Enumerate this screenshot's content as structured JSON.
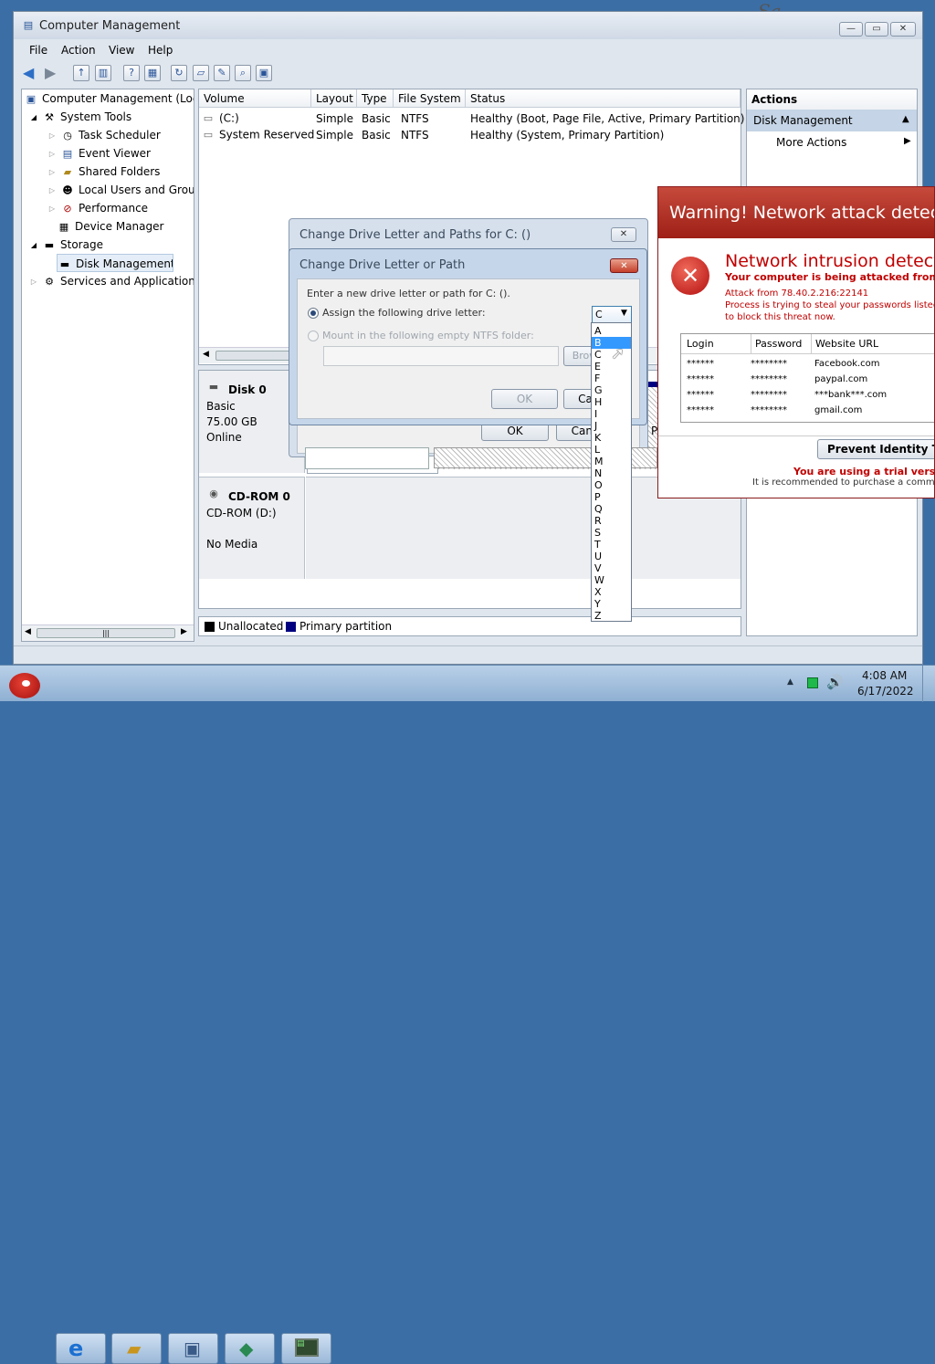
{
  "desktop": {
    "corner_text": "Sa"
  },
  "window": {
    "title": "Computer Management",
    "menu": [
      "File",
      "Action",
      "View",
      "Help"
    ],
    "tree": [
      {
        "label": "Computer Management (Local"
      },
      {
        "label": "System Tools"
      },
      {
        "label": "Task Scheduler"
      },
      {
        "label": "Event Viewer"
      },
      {
        "label": "Shared Folders"
      },
      {
        "label": "Local Users and Groups"
      },
      {
        "label": "Performance"
      },
      {
        "label": "Device Manager"
      },
      {
        "label": "Storage"
      },
      {
        "label": "Disk Management"
      },
      {
        "label": "Services and Applications"
      }
    ],
    "volume_table": {
      "headers": [
        "Volume",
        "Layout",
        "Type",
        "File System",
        "Status"
      ],
      "rows": [
        [
          "(C:)",
          "Simple",
          "Basic",
          "NTFS",
          "Healthy (Boot, Page File, Active, Primary Partition)"
        ],
        [
          "System Reserved",
          "Simple",
          "Basic",
          "NTFS",
          "Healthy (System, Primary Partition)"
        ]
      ]
    },
    "disks": [
      {
        "name": "Disk 0",
        "type": "Basic",
        "size": "75.00 GB",
        "state": "Online"
      },
      {
        "name": "CD-ROM 0",
        "type": "CD-ROM (D:)",
        "state": "No Media"
      }
    ],
    "legend": {
      "unallocated": "Unallocated",
      "primary": "Primary partition",
      "unallocated_color": "#000000",
      "primary_color": "#000080"
    },
    "actions": {
      "header": "Actions",
      "section": "Disk Management",
      "more": "More Actions"
    }
  },
  "dialog_back": {
    "title": "Change Drive Letter and Paths for C: ()",
    "ok": "OK",
    "cancel": "Cancel",
    "p": "P"
  },
  "dialog_front": {
    "title": "Change Drive Letter or Path",
    "instruction": "Enter a new drive letter or path for C: ().",
    "assign_label": "Assign the following drive letter:",
    "mount_label": "Mount in the following empty NTFS folder:",
    "browse": "Browse...",
    "ok": "OK",
    "cancel": "Cancel",
    "selected_letter": "C",
    "letters": [
      "A",
      "B",
      "C",
      "E",
      "F",
      "G",
      "H",
      "I",
      "J",
      "K",
      "L",
      "M",
      "N",
      "O",
      "P",
      "Q",
      "R",
      "S",
      "T",
      "U",
      "V",
      "W",
      "X",
      "Y",
      "Z"
    ],
    "highlighted": "B"
  },
  "warning": {
    "title": "Warning! Network attack detected",
    "heading": "Network intrusion detected",
    "subheading": "Your computer is being attacked from a remote machine!",
    "attack_from": "Attack from 78.40.2.216:22141",
    "body": "Process is trying to steal your passwords listed below. It is highly recommended to block this threat now.",
    "table_headers": [
      "Login",
      "Password",
      "Website URL"
    ],
    "table_rows": [
      [
        "******",
        "********",
        "Facebook.com"
      ],
      [
        "******",
        "********",
        "paypal.com"
      ],
      [
        "******",
        "********",
        "***bank***.com"
      ],
      [
        "******",
        "********",
        "gmail.com"
      ]
    ],
    "button": "Prevent Identity Theft",
    "trial": "You are using a trial version",
    "purchase": "It is recommended to purchase a commercial version",
    "accent": "#c00000"
  },
  "taskbar": {
    "time": "4:08 AM",
    "date": "6/17/2022",
    "apps": [
      "angry-birds-start",
      "internet-explorer",
      "file-manager",
      "computer",
      "network-app",
      "terminal"
    ]
  }
}
